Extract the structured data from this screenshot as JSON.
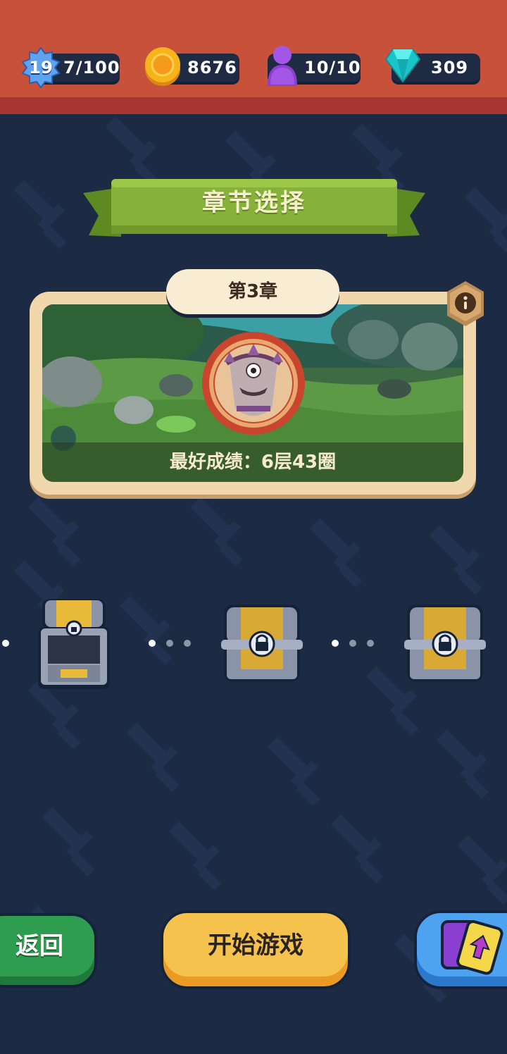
{
  "resources": {
    "level": "19",
    "xp": "7/100",
    "coins": "8676",
    "stamina": "10/10",
    "gems": "309"
  },
  "header": {
    "title": "章节选择"
  },
  "chapter": {
    "label": "第3章",
    "best_score": "最好成绩：6层43圈"
  },
  "chests": [
    {
      "state": "opened"
    },
    {
      "state": "locked"
    },
    {
      "state": "locked"
    }
  ],
  "buttons": {
    "back": "返回",
    "start": "开始游戏",
    "cards_icon": "card-upgrade-icon"
  },
  "colors": {
    "background": "#1c2a44",
    "topbar": "#c8513a",
    "ribbon": "#86b13a",
    "start_button": "#f6c24e",
    "back_button": "#2f9d4f",
    "cards_button": "#4da3ef"
  }
}
